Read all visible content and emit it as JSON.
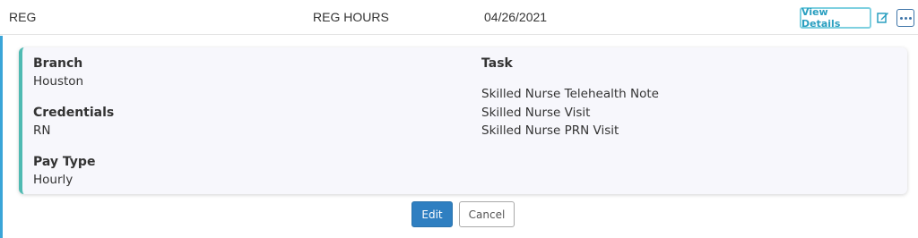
{
  "row": {
    "type": "REG",
    "hours_type": "REG HOURS",
    "date": "04/26/2021",
    "view_details_label": "View Details"
  },
  "details": {
    "branch_label": "Branch",
    "branch_value": "Houston",
    "credentials_label": "Credentials",
    "credentials_value": "RN",
    "pay_type_label": "Pay Type",
    "pay_type_value": "Hourly",
    "task_label": "Task",
    "tasks": [
      "Skilled Nurse Telehealth Note",
      "Skilled Nurse Visit",
      "Skilled Nurse PRN Visit"
    ]
  },
  "actions": {
    "edit_label": "Edit",
    "cancel_label": "Cancel"
  },
  "colors": {
    "accent_teal": "#4fbab2",
    "accent_blue": "#3aa5d8",
    "primary_button": "#2f7fc1"
  },
  "icons": {
    "edit": "edit-icon",
    "more": "more-options-icon"
  }
}
